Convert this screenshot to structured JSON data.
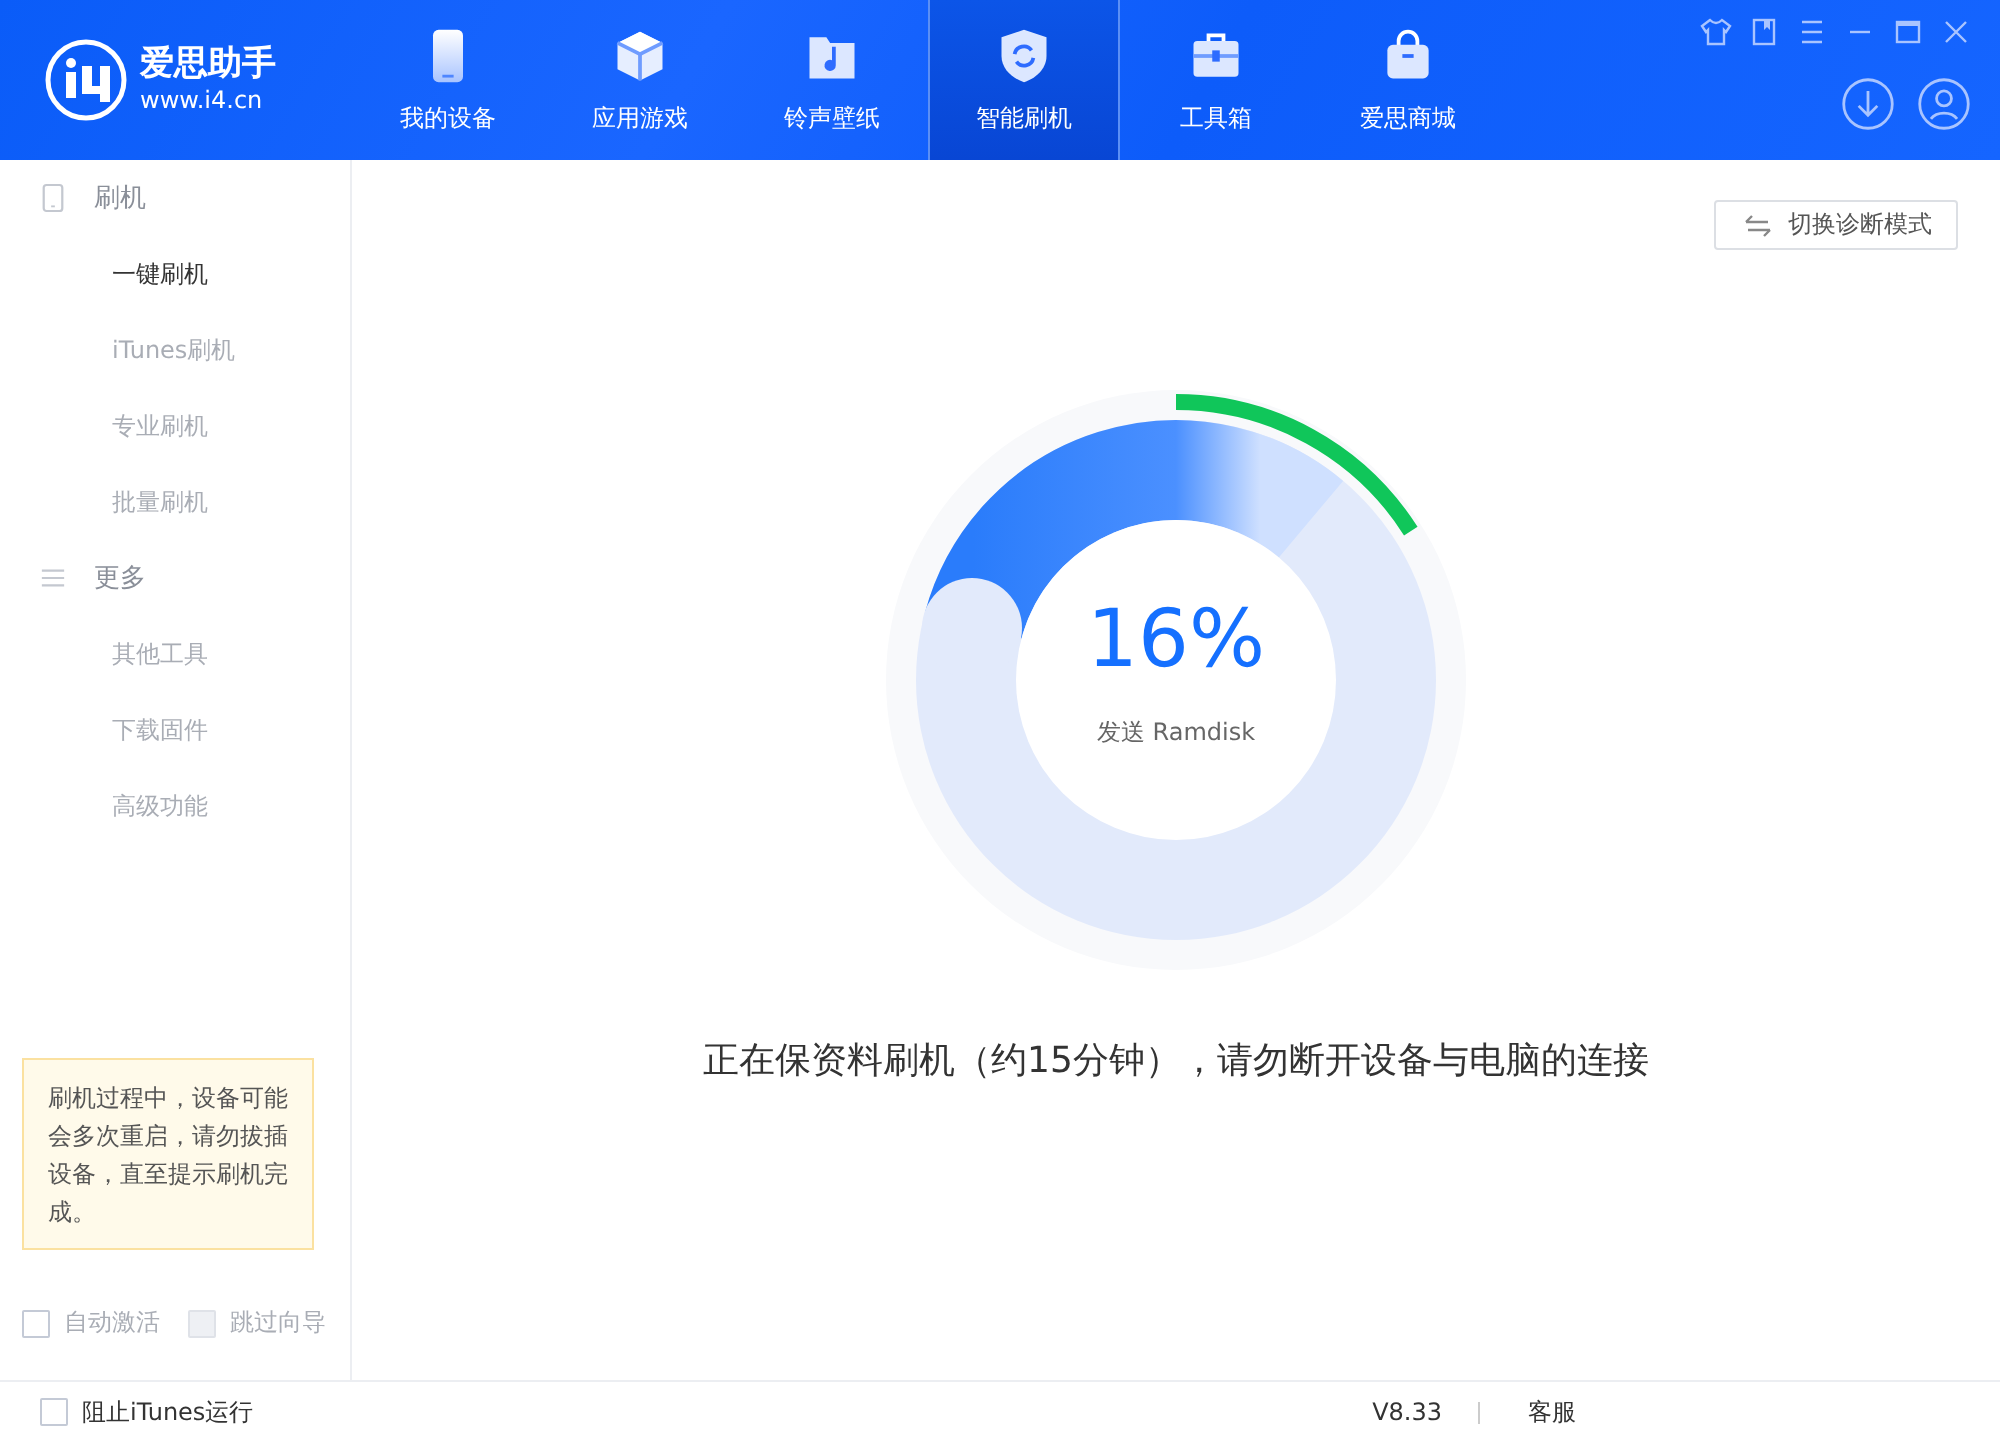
{
  "app": {
    "name": "爱思助手",
    "url": "www.i4.cn"
  },
  "nav": [
    {
      "label": "我的设备",
      "selected": false
    },
    {
      "label": "应用游戏",
      "selected": false
    },
    {
      "label": "铃声壁纸",
      "selected": false
    },
    {
      "label": "智能刷机",
      "selected": true
    },
    {
      "label": "工具箱",
      "selected": false
    },
    {
      "label": "爱思商城",
      "selected": false
    }
  ],
  "sidebar": {
    "groups": [
      {
        "title": "刷机",
        "items": [
          {
            "label": "一键刷机",
            "selected": true
          },
          {
            "label": "iTunes刷机",
            "selected": false
          },
          {
            "label": "专业刷机",
            "selected": false
          },
          {
            "label": "批量刷机",
            "selected": false
          }
        ]
      },
      {
        "title": "更多",
        "items": [
          {
            "label": "其他工具",
            "selected": false
          },
          {
            "label": "下载固件",
            "selected": false
          },
          {
            "label": "高级功能",
            "selected": false
          }
        ]
      }
    ]
  },
  "tip": "刷机过程中，设备可能会多次重启，请勿拔插设备，直至提示刷机完成。",
  "options": [
    {
      "label": "自动激活",
      "checked": false,
      "disabled": false
    },
    {
      "label": "跳过向导",
      "checked": false,
      "disabled": true
    }
  ],
  "mode_button": "切换诊断模式",
  "progress": {
    "percent": "16%",
    "step": "发送 Ramdisk",
    "level": 0.16
  },
  "message": "正在保资料刷机（约15分钟），请勿断开设备与电脑的连接",
  "status_bar": {
    "block_itunes": {
      "label": "阻止iTunes运行",
      "checked": false
    },
    "version": "V8.33",
    "support": "客服"
  }
}
